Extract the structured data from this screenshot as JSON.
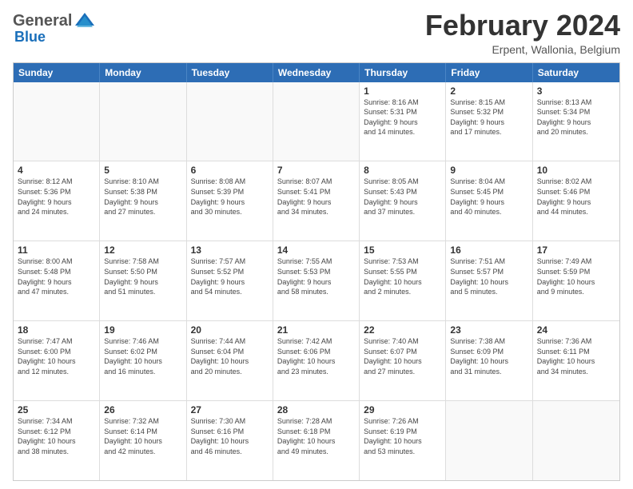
{
  "header": {
    "logo_general": "General",
    "logo_blue": "Blue",
    "title": "February 2024",
    "subtitle": "Erpent, Wallonia, Belgium"
  },
  "calendar": {
    "days_of_week": [
      "Sunday",
      "Monday",
      "Tuesday",
      "Wednesday",
      "Thursday",
      "Friday",
      "Saturday"
    ],
    "rows": [
      [
        {
          "day": "",
          "info": "",
          "empty": true
        },
        {
          "day": "",
          "info": "",
          "empty": true
        },
        {
          "day": "",
          "info": "",
          "empty": true
        },
        {
          "day": "",
          "info": "",
          "empty": true
        },
        {
          "day": "1",
          "info": "Sunrise: 8:16 AM\nSunset: 5:31 PM\nDaylight: 9 hours\nand 14 minutes."
        },
        {
          "day": "2",
          "info": "Sunrise: 8:15 AM\nSunset: 5:32 PM\nDaylight: 9 hours\nand 17 minutes."
        },
        {
          "day": "3",
          "info": "Sunrise: 8:13 AM\nSunset: 5:34 PM\nDaylight: 9 hours\nand 20 minutes."
        }
      ],
      [
        {
          "day": "4",
          "info": "Sunrise: 8:12 AM\nSunset: 5:36 PM\nDaylight: 9 hours\nand 24 minutes."
        },
        {
          "day": "5",
          "info": "Sunrise: 8:10 AM\nSunset: 5:38 PM\nDaylight: 9 hours\nand 27 minutes."
        },
        {
          "day": "6",
          "info": "Sunrise: 8:08 AM\nSunset: 5:39 PM\nDaylight: 9 hours\nand 30 minutes."
        },
        {
          "day": "7",
          "info": "Sunrise: 8:07 AM\nSunset: 5:41 PM\nDaylight: 9 hours\nand 34 minutes."
        },
        {
          "day": "8",
          "info": "Sunrise: 8:05 AM\nSunset: 5:43 PM\nDaylight: 9 hours\nand 37 minutes."
        },
        {
          "day": "9",
          "info": "Sunrise: 8:04 AM\nSunset: 5:45 PM\nDaylight: 9 hours\nand 40 minutes."
        },
        {
          "day": "10",
          "info": "Sunrise: 8:02 AM\nSunset: 5:46 PM\nDaylight: 9 hours\nand 44 minutes."
        }
      ],
      [
        {
          "day": "11",
          "info": "Sunrise: 8:00 AM\nSunset: 5:48 PM\nDaylight: 9 hours\nand 47 minutes."
        },
        {
          "day": "12",
          "info": "Sunrise: 7:58 AM\nSunset: 5:50 PM\nDaylight: 9 hours\nand 51 minutes."
        },
        {
          "day": "13",
          "info": "Sunrise: 7:57 AM\nSunset: 5:52 PM\nDaylight: 9 hours\nand 54 minutes."
        },
        {
          "day": "14",
          "info": "Sunrise: 7:55 AM\nSunset: 5:53 PM\nDaylight: 9 hours\nand 58 minutes."
        },
        {
          "day": "15",
          "info": "Sunrise: 7:53 AM\nSunset: 5:55 PM\nDaylight: 10 hours\nand 2 minutes."
        },
        {
          "day": "16",
          "info": "Sunrise: 7:51 AM\nSunset: 5:57 PM\nDaylight: 10 hours\nand 5 minutes."
        },
        {
          "day": "17",
          "info": "Sunrise: 7:49 AM\nSunset: 5:59 PM\nDaylight: 10 hours\nand 9 minutes."
        }
      ],
      [
        {
          "day": "18",
          "info": "Sunrise: 7:47 AM\nSunset: 6:00 PM\nDaylight: 10 hours\nand 12 minutes."
        },
        {
          "day": "19",
          "info": "Sunrise: 7:46 AM\nSunset: 6:02 PM\nDaylight: 10 hours\nand 16 minutes."
        },
        {
          "day": "20",
          "info": "Sunrise: 7:44 AM\nSunset: 6:04 PM\nDaylight: 10 hours\nand 20 minutes."
        },
        {
          "day": "21",
          "info": "Sunrise: 7:42 AM\nSunset: 6:06 PM\nDaylight: 10 hours\nand 23 minutes."
        },
        {
          "day": "22",
          "info": "Sunrise: 7:40 AM\nSunset: 6:07 PM\nDaylight: 10 hours\nand 27 minutes."
        },
        {
          "day": "23",
          "info": "Sunrise: 7:38 AM\nSunset: 6:09 PM\nDaylight: 10 hours\nand 31 minutes."
        },
        {
          "day": "24",
          "info": "Sunrise: 7:36 AM\nSunset: 6:11 PM\nDaylight: 10 hours\nand 34 minutes."
        }
      ],
      [
        {
          "day": "25",
          "info": "Sunrise: 7:34 AM\nSunset: 6:12 PM\nDaylight: 10 hours\nand 38 minutes."
        },
        {
          "day": "26",
          "info": "Sunrise: 7:32 AM\nSunset: 6:14 PM\nDaylight: 10 hours\nand 42 minutes."
        },
        {
          "day": "27",
          "info": "Sunrise: 7:30 AM\nSunset: 6:16 PM\nDaylight: 10 hours\nand 46 minutes."
        },
        {
          "day": "28",
          "info": "Sunrise: 7:28 AM\nSunset: 6:18 PM\nDaylight: 10 hours\nand 49 minutes."
        },
        {
          "day": "29",
          "info": "Sunrise: 7:26 AM\nSunset: 6:19 PM\nDaylight: 10 hours\nand 53 minutes."
        },
        {
          "day": "",
          "info": "",
          "empty": true
        },
        {
          "day": "",
          "info": "",
          "empty": true
        }
      ]
    ]
  }
}
